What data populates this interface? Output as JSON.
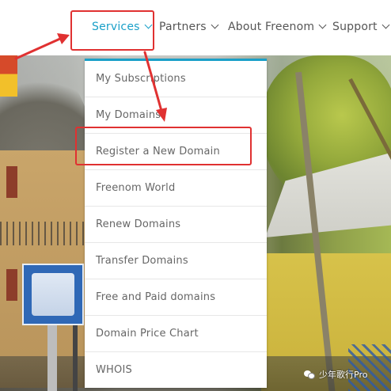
{
  "nav": {
    "items": [
      {
        "label": "Services",
        "active": true
      },
      {
        "label": "Partners",
        "active": false
      },
      {
        "label": "About Freenom",
        "active": false
      },
      {
        "label": "Support",
        "active": false
      }
    ],
    "chevron_icon": "chevron-down-icon"
  },
  "services_menu": {
    "items": [
      {
        "label": "My Subscriptions"
      },
      {
        "label": "My Domains"
      },
      {
        "label": "Register a New Domain",
        "highlighted": true
      },
      {
        "label": "Freenom World"
      },
      {
        "label": "Renew Domains"
      },
      {
        "label": "Transfer Domains"
      },
      {
        "label": "Free and Paid domains"
      },
      {
        "label": "Domain Price Chart"
      },
      {
        "label": "WHOIS"
      }
    ]
  },
  "annotations": {
    "color": "#e03131",
    "highlighted_targets": [
      "Services",
      "Register a New Domain"
    ]
  },
  "watermark": {
    "text": "少年歌行Pro",
    "icon": "wechat-icon"
  },
  "colors": {
    "accent": "#1aa0c8",
    "text": "#666666",
    "annotation": "#e03131"
  }
}
